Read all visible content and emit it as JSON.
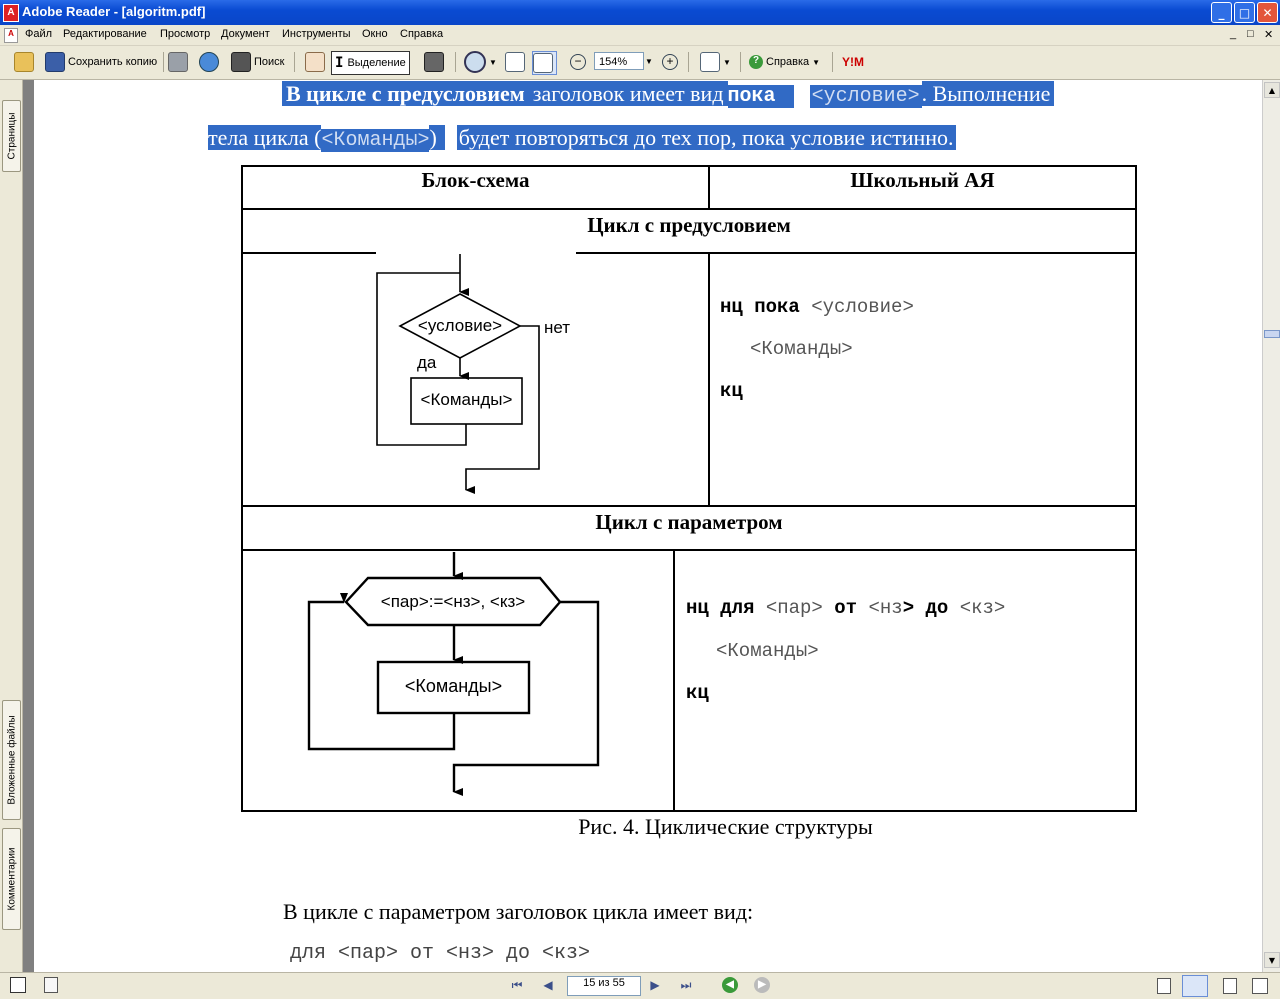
{
  "window": {
    "title": "Adobe Reader - [algoritm.pdf]",
    "minimize": "_",
    "maximize": "□",
    "close": "✕",
    "doc_controls": [
      "_",
      "□",
      "✕"
    ]
  },
  "menu": [
    "Файл",
    "Редактирование",
    "Просмотр",
    "Документ",
    "Инструменты",
    "Окно",
    "Справка"
  ],
  "toolbar": {
    "save_copy": "Сохранить копию",
    "search": "Поиск",
    "select": "Выделение",
    "zoom": "154%",
    "help": "Справка"
  },
  "side_tabs": [
    "Страницы",
    "Вложенные файлы",
    "Комментарии"
  ],
  "page": {
    "intro_line1_bold": "В цикле с предусловием",
    "intro_line1_a": "заголовок имеет вид",
    "intro_line1_kw": "пока",
    "intro_line1_cond": "<условие>",
    "intro_line1_b": ". Выполнение",
    "intro_line2_a": "тела цикла (",
    "intro_line2_cmd": "<Команды>",
    "intro_line2_b": ")",
    "intro_line2_c": "будет повторяться до тех пор, пока условие истинно.",
    "table": {
      "col1": "Блок-схема",
      "col2": "Школьный АЯ",
      "section1": "Цикл с предусловием",
      "section2": "Цикл с параметром",
      "flow1": {
        "condition": "<условие>",
        "no": "нет",
        "yes": "да",
        "commands": "<Команды>"
      },
      "flow2": {
        "header": "<пар>:=<нз>, <кз>",
        "commands": "<Команды>"
      },
      "code1": {
        "kw1": "нц пока",
        "cond": "<условие>",
        "cmds": "<Команды>",
        "end": "кц"
      },
      "code2": {
        "kw1": "нц для",
        "par": "<пар>",
        "kw2": "от",
        "nz": "<нз",
        "gt": ">",
        "kw3": "до",
        "kz": "<кз>",
        "cmds": "<Команды>",
        "end": "кц"
      }
    },
    "caption": "Рис. 4. Циклические структуры",
    "para2": "В цикле с параметром заголовок цикла имеет вид:",
    "para2_code": "для <пар> от <нз> до <кз>"
  },
  "status": {
    "page_indicator": "15 из 55"
  }
}
